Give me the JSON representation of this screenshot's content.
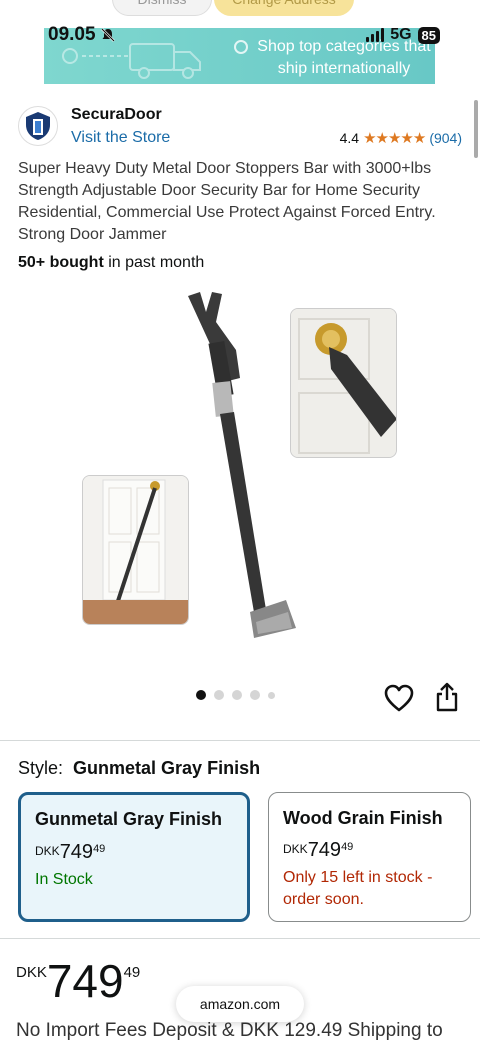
{
  "status_bar": {
    "time": "09.05",
    "network": "5G",
    "battery": "85"
  },
  "top_buttons": {
    "dismiss": "Dismiss",
    "change_address": "Change Address"
  },
  "promo": {
    "text": "Shop top categories that ship internationally"
  },
  "brand": {
    "name": "SecuraDoor",
    "visit_store": "Visit the Store"
  },
  "rating": {
    "value": "4.4",
    "stars": "★★★★★",
    "count": "(904)"
  },
  "product": {
    "title": "Super Heavy Duty Metal Door Stoppers Bar with 3000+lbs Strength Adjustable Door Security Bar for Home Security Residential, Commercial Use Protect Against Forced Entry. Strong Door Jammer",
    "bought_bold": "50+ bought",
    "bought_rest": " in past month"
  },
  "style": {
    "label": "Style:",
    "selected_value": "Gunmetal Gray Finish",
    "options": [
      {
        "name": "Gunmetal Gray Finish",
        "currency": "DKK",
        "whole": "749",
        "fraction": "49",
        "stock": "In Stock"
      },
      {
        "name": "Wood Grain Finish",
        "currency": "DKK",
        "whole": "749",
        "fraction": "49",
        "stock": "Only 15 left in stock - order soon."
      }
    ]
  },
  "price": {
    "currency": "DKK",
    "whole": "749",
    "fraction": "49"
  },
  "browser": {
    "url": "amazon.com"
  },
  "shipping": {
    "text": "No Import Fees Deposit & DKK 129.49 Shipping to"
  },
  "colors": {
    "link": "#1b6ca8",
    "star": "#de7921",
    "in_stock": "#007600",
    "low_stock": "#b12704",
    "selected_border": "#1f5f8b"
  }
}
